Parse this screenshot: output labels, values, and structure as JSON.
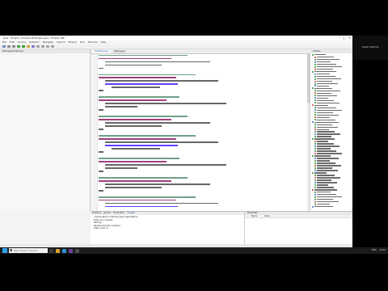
{
  "window": {
    "title": "Java - Project_name/src/Example.java - Eclipse IDE",
    "controls": [
      "–",
      "□",
      "×"
    ]
  },
  "menu": [
    "File",
    "Edit",
    "Source",
    "Refactor",
    "Navigate",
    "Search",
    "Project",
    "Run",
    "Window",
    "Help"
  ],
  "left_panel": {
    "tab": "Package Explorer"
  },
  "editor_tabs": [
    {
      "label": "Example.java",
      "active": true
    },
    {
      "label": "Main.java",
      "active": false
    }
  ],
  "outline": {
    "tab": "Outline"
  },
  "console": {
    "tabs": [
      "Problems",
      "Javadoc",
      "Declaration",
      "Console"
    ],
    "lines": [
      "<terminated> Example [Java Application]",
      "",
      "Enter any number:",
      "",
      "Writing...",
      "",
      "",
      "Reading the file contents...",
      "",
      "Total count: 8"
    ]
  },
  "properties": {
    "tab": "Properties",
    "columns": [
      "Name",
      "Value"
    ]
  },
  "webcam": {
    "name": "Anjali Sharma"
  },
  "taskbar": {
    "search_placeholder": "Type here to search",
    "tray_text": "ENG",
    "time": "10:42"
  }
}
